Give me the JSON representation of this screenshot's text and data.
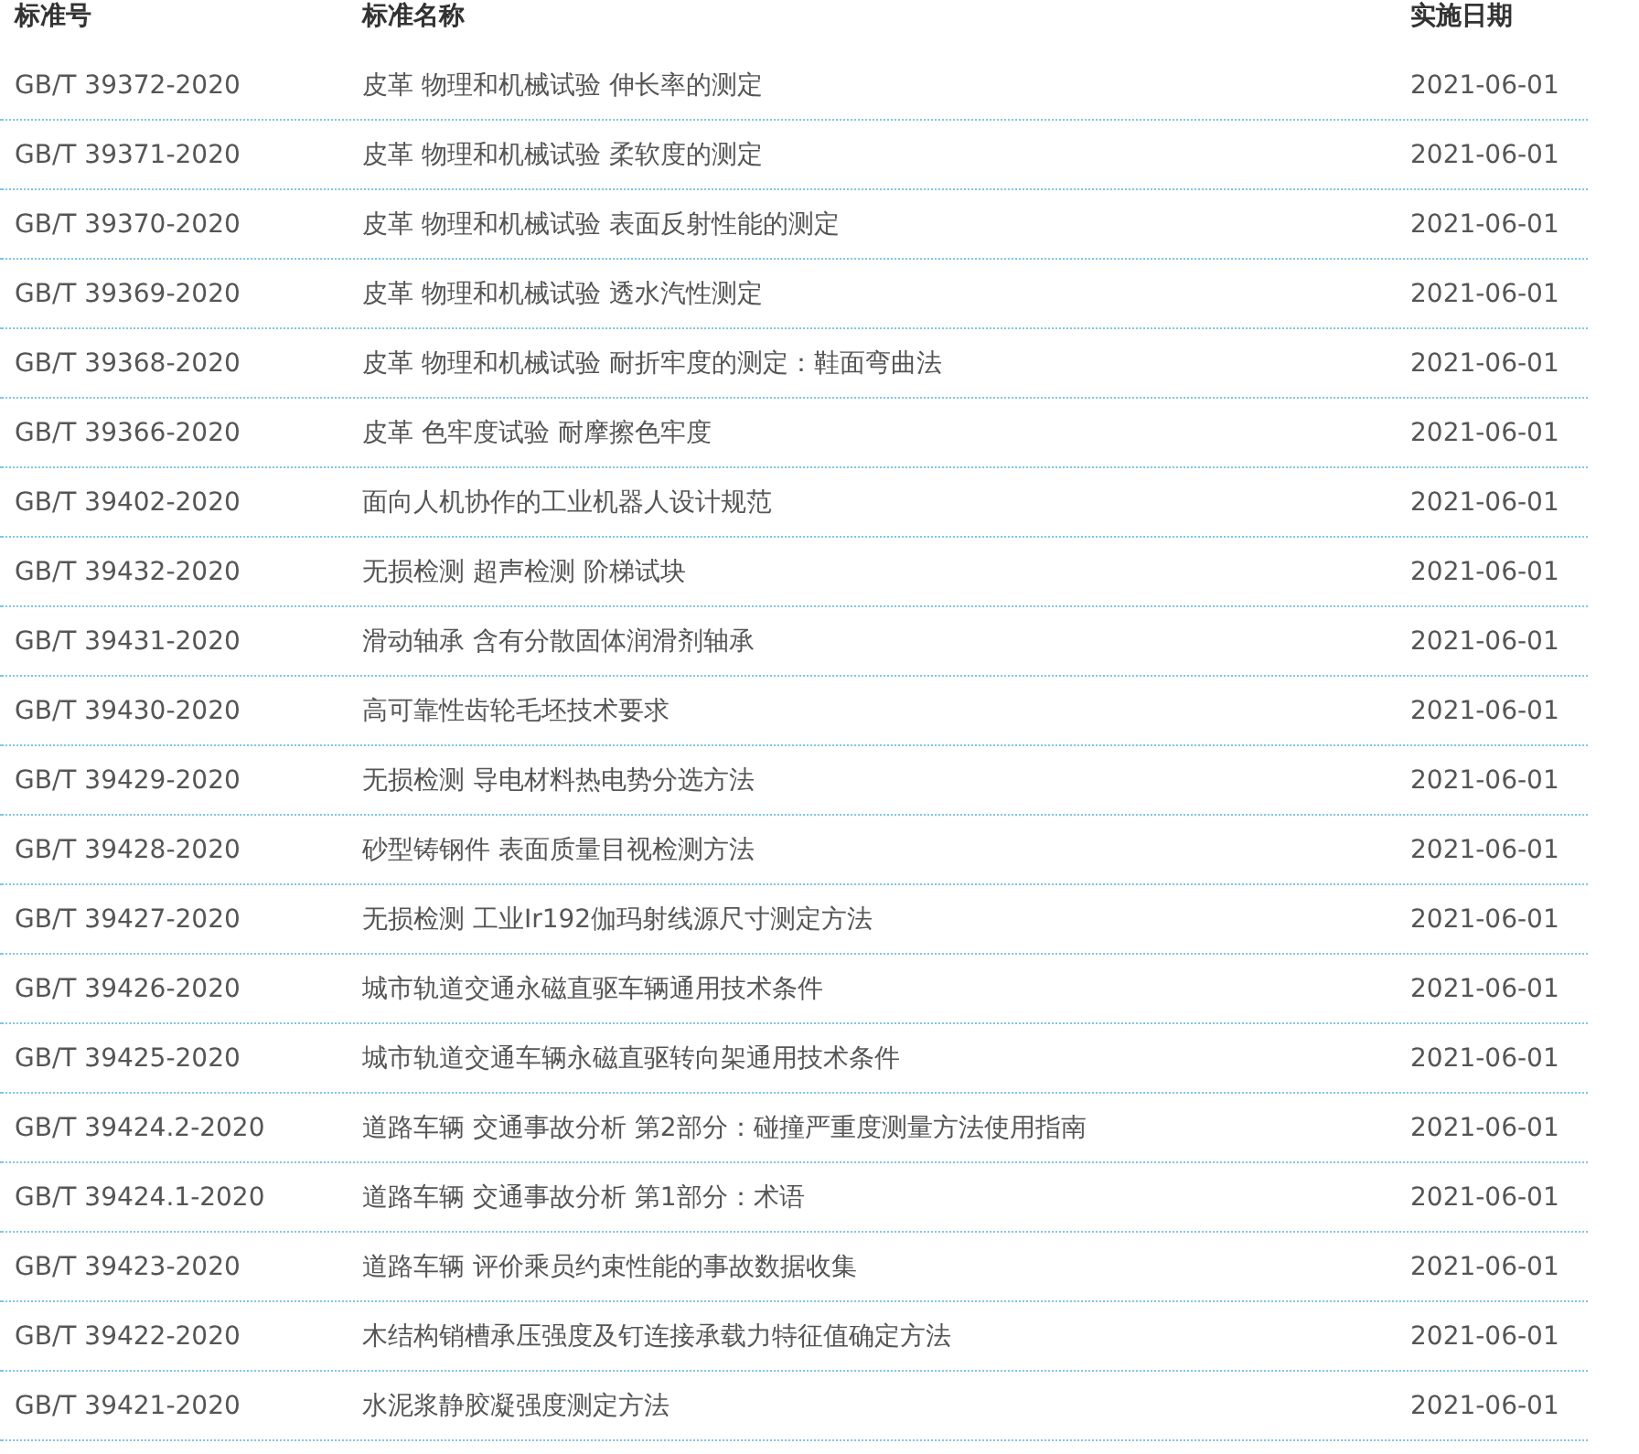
{
  "table": {
    "columns": [
      "标准号",
      "标准名称",
      "实施日期"
    ],
    "rows": [
      [
        "GB/T 39372-2020",
        "皮革 物理和机械试验 伸长率的测定",
        "2021-06-01"
      ],
      [
        "GB/T 39371-2020",
        "皮革 物理和机械试验 柔软度的测定",
        "2021-06-01"
      ],
      [
        "GB/T 39370-2020",
        "皮革 物理和机械试验 表面反射性能的测定",
        "2021-06-01"
      ],
      [
        "GB/T 39369-2020",
        "皮革 物理和机械试验 透水汽性测定",
        "2021-06-01"
      ],
      [
        "GB/T 39368-2020",
        "皮革 物理和机械试验 耐折牢度的测定：鞋面弯曲法",
        "2021-06-01"
      ],
      [
        "GB/T 39366-2020",
        "皮革 色牢度试验 耐摩擦色牢度",
        "2021-06-01"
      ],
      [
        "GB/T 39402-2020",
        "面向人机协作的工业机器人设计规范",
        "2021-06-01"
      ],
      [
        "GB/T 39432-2020",
        "无损检测 超声检测 阶梯试块",
        "2021-06-01"
      ],
      [
        "GB/T 39431-2020",
        "滑动轴承 含有分散固体润滑剂轴承",
        "2021-06-01"
      ],
      [
        "GB/T 39430-2020",
        "高可靠性齿轮毛坯技术要求",
        "2021-06-01"
      ],
      [
        "GB/T 39429-2020",
        "无损检测 导电材料热电势分选方法",
        "2021-06-01"
      ],
      [
        "GB/T 39428-2020",
        "砂型铸钢件 表面质量目视检测方法",
        "2021-06-01"
      ],
      [
        "GB/T 39427-2020",
        "无损检测 工业Ir192伽玛射线源尺寸测定方法",
        "2021-06-01"
      ],
      [
        "GB/T 39426-2020",
        "城市轨道交通永磁直驱车辆通用技术条件",
        "2021-06-01"
      ],
      [
        "GB/T 39425-2020",
        "城市轨道交通车辆永磁直驱转向架通用技术条件",
        "2021-06-01"
      ],
      [
        "GB/T 39424.2-2020",
        "道路车辆 交通事故分析 第2部分：碰撞严重度测量方法使用指南",
        "2021-06-01"
      ],
      [
        "GB/T 39424.1-2020",
        "道路车辆 交通事故分析 第1部分：术语",
        "2021-06-01"
      ],
      [
        "GB/T 39423-2020",
        "道路车辆 评价乘员约束性能的事故数据收集",
        "2021-06-01"
      ],
      [
        "GB/T 39422-2020",
        "木结构销槽承压强度及钉连接承载力特征值确定方法",
        "2021-06-01"
      ],
      [
        "GB/T 39421-2020",
        "水泥浆静胶凝强度测定方法",
        "2021-06-01"
      ]
    ]
  }
}
